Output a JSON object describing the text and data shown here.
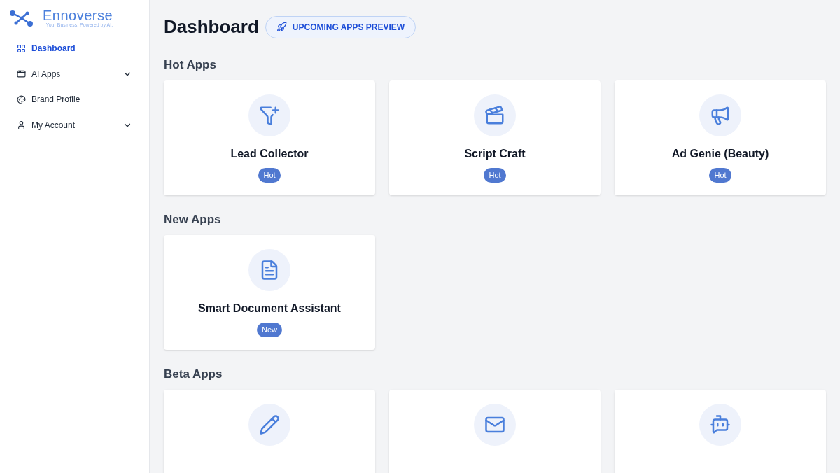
{
  "brand": {
    "name": "Ennoverse",
    "tagline": "Your Business. Powered by AI."
  },
  "sidebar": {
    "items": [
      {
        "label": "Dashboard",
        "selected": true
      },
      {
        "label": "AI Apps",
        "selected": false,
        "expanded": false
      },
      {
        "label": "Brand Profile",
        "selected": false
      },
      {
        "label": "My Account",
        "selected": false,
        "expanded": false
      }
    ]
  },
  "header": {
    "title": "Dashboard",
    "button": "UPCOMING APPS PREVIEW"
  },
  "sections": [
    {
      "heading": "Hot Apps",
      "cards": [
        {
          "title": "Lead Collector",
          "badge": "Hot"
        },
        {
          "title": "Script Craft",
          "badge": "Hot"
        },
        {
          "title": "Ad Genie (Beauty)",
          "badge": "Hot"
        }
      ]
    },
    {
      "heading": "New Apps",
      "cards": [
        {
          "title": "Smart Document Assistant",
          "badge": "New"
        }
      ]
    },
    {
      "heading": "Beta Apps",
      "cards": [
        {
          "kind": "pencil"
        },
        {
          "kind": "mail"
        },
        {
          "kind": "bot"
        }
      ]
    }
  ]
}
